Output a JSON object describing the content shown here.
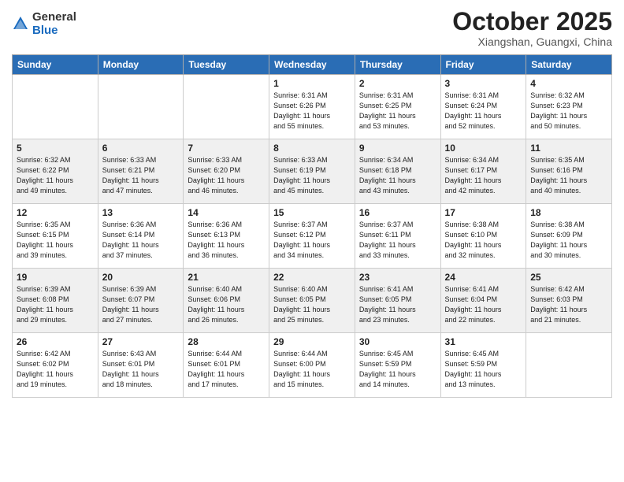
{
  "header": {
    "logo": {
      "general": "General",
      "blue": "Blue"
    },
    "title": "October 2025",
    "location": "Xiangshan, Guangxi, China"
  },
  "days_of_week": [
    "Sunday",
    "Monday",
    "Tuesday",
    "Wednesday",
    "Thursday",
    "Friday",
    "Saturday"
  ],
  "weeks": [
    [
      {
        "day": "",
        "info": ""
      },
      {
        "day": "",
        "info": ""
      },
      {
        "day": "",
        "info": ""
      },
      {
        "day": "1",
        "info": "Sunrise: 6:31 AM\nSunset: 6:26 PM\nDaylight: 11 hours\nand 55 minutes."
      },
      {
        "day": "2",
        "info": "Sunrise: 6:31 AM\nSunset: 6:25 PM\nDaylight: 11 hours\nand 53 minutes."
      },
      {
        "day": "3",
        "info": "Sunrise: 6:31 AM\nSunset: 6:24 PM\nDaylight: 11 hours\nand 52 minutes."
      },
      {
        "day": "4",
        "info": "Sunrise: 6:32 AM\nSunset: 6:23 PM\nDaylight: 11 hours\nand 50 minutes."
      }
    ],
    [
      {
        "day": "5",
        "info": "Sunrise: 6:32 AM\nSunset: 6:22 PM\nDaylight: 11 hours\nand 49 minutes."
      },
      {
        "day": "6",
        "info": "Sunrise: 6:33 AM\nSunset: 6:21 PM\nDaylight: 11 hours\nand 47 minutes."
      },
      {
        "day": "7",
        "info": "Sunrise: 6:33 AM\nSunset: 6:20 PM\nDaylight: 11 hours\nand 46 minutes."
      },
      {
        "day": "8",
        "info": "Sunrise: 6:33 AM\nSunset: 6:19 PM\nDaylight: 11 hours\nand 45 minutes."
      },
      {
        "day": "9",
        "info": "Sunrise: 6:34 AM\nSunset: 6:18 PM\nDaylight: 11 hours\nand 43 minutes."
      },
      {
        "day": "10",
        "info": "Sunrise: 6:34 AM\nSunset: 6:17 PM\nDaylight: 11 hours\nand 42 minutes."
      },
      {
        "day": "11",
        "info": "Sunrise: 6:35 AM\nSunset: 6:16 PM\nDaylight: 11 hours\nand 40 minutes."
      }
    ],
    [
      {
        "day": "12",
        "info": "Sunrise: 6:35 AM\nSunset: 6:15 PM\nDaylight: 11 hours\nand 39 minutes."
      },
      {
        "day": "13",
        "info": "Sunrise: 6:36 AM\nSunset: 6:14 PM\nDaylight: 11 hours\nand 37 minutes."
      },
      {
        "day": "14",
        "info": "Sunrise: 6:36 AM\nSunset: 6:13 PM\nDaylight: 11 hours\nand 36 minutes."
      },
      {
        "day": "15",
        "info": "Sunrise: 6:37 AM\nSunset: 6:12 PM\nDaylight: 11 hours\nand 34 minutes."
      },
      {
        "day": "16",
        "info": "Sunrise: 6:37 AM\nSunset: 6:11 PM\nDaylight: 11 hours\nand 33 minutes."
      },
      {
        "day": "17",
        "info": "Sunrise: 6:38 AM\nSunset: 6:10 PM\nDaylight: 11 hours\nand 32 minutes."
      },
      {
        "day": "18",
        "info": "Sunrise: 6:38 AM\nSunset: 6:09 PM\nDaylight: 11 hours\nand 30 minutes."
      }
    ],
    [
      {
        "day": "19",
        "info": "Sunrise: 6:39 AM\nSunset: 6:08 PM\nDaylight: 11 hours\nand 29 minutes."
      },
      {
        "day": "20",
        "info": "Sunrise: 6:39 AM\nSunset: 6:07 PM\nDaylight: 11 hours\nand 27 minutes."
      },
      {
        "day": "21",
        "info": "Sunrise: 6:40 AM\nSunset: 6:06 PM\nDaylight: 11 hours\nand 26 minutes."
      },
      {
        "day": "22",
        "info": "Sunrise: 6:40 AM\nSunset: 6:05 PM\nDaylight: 11 hours\nand 25 minutes."
      },
      {
        "day": "23",
        "info": "Sunrise: 6:41 AM\nSunset: 6:05 PM\nDaylight: 11 hours\nand 23 minutes."
      },
      {
        "day": "24",
        "info": "Sunrise: 6:41 AM\nSunset: 6:04 PM\nDaylight: 11 hours\nand 22 minutes."
      },
      {
        "day": "25",
        "info": "Sunrise: 6:42 AM\nSunset: 6:03 PM\nDaylight: 11 hours\nand 21 minutes."
      }
    ],
    [
      {
        "day": "26",
        "info": "Sunrise: 6:42 AM\nSunset: 6:02 PM\nDaylight: 11 hours\nand 19 minutes."
      },
      {
        "day": "27",
        "info": "Sunrise: 6:43 AM\nSunset: 6:01 PM\nDaylight: 11 hours\nand 18 minutes."
      },
      {
        "day": "28",
        "info": "Sunrise: 6:44 AM\nSunset: 6:01 PM\nDaylight: 11 hours\nand 17 minutes."
      },
      {
        "day": "29",
        "info": "Sunrise: 6:44 AM\nSunset: 6:00 PM\nDaylight: 11 hours\nand 15 minutes."
      },
      {
        "day": "30",
        "info": "Sunrise: 6:45 AM\nSunset: 5:59 PM\nDaylight: 11 hours\nand 14 minutes."
      },
      {
        "day": "31",
        "info": "Sunrise: 6:45 AM\nSunset: 5:59 PM\nDaylight: 11 hours\nand 13 minutes."
      },
      {
        "day": "",
        "info": ""
      }
    ]
  ],
  "alt_rows": [
    1,
    3
  ]
}
